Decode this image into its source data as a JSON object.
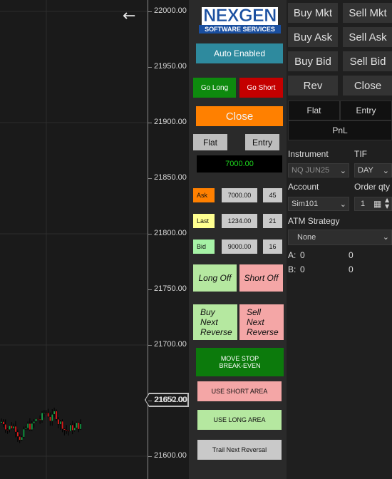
{
  "chart": {
    "price_ticks": [
      "22000.00",
      "21950.00",
      "21900.00",
      "21850.00",
      "21800.00",
      "21750.00",
      "21700.00",
      "21650.00",
      "21600.00"
    ],
    "current_price": "21652.00",
    "back_icon": "arrow-left-icon",
    "up_color": "#17a34a",
    "down_color": "#e01b1b"
  },
  "logo": {
    "top": "NEXGEN",
    "bottom": "SOFTWARE SERVICES"
  },
  "mid": {
    "auto": "Auto Enabled",
    "go_long": "Go Long",
    "go_short": "Go Short",
    "close": "Close",
    "flat": "Flat",
    "entry": "Entry",
    "display": "7000.00",
    "ask_label": "Ask",
    "ask_price": "7000.00",
    "ask_qty": "45",
    "last_label": "Last",
    "last_price": "1234.00",
    "last_qty": "21",
    "bid_label": "Bid",
    "bid_price": "9000.00",
    "bid_qty": "16",
    "long_off": "Long Off",
    "short_off": "Short Off",
    "buy_next_reverse": [
      "Buy",
      "Next",
      "Reverse"
    ],
    "sell_next_reverse": [
      "Sell",
      "Next",
      "Reverse"
    ],
    "move_stop": [
      "MOVE STOP",
      "BREAK-EVEN"
    ],
    "use_short_area": "USE SHORT AREA",
    "use_long_area": "USE LONG AREA",
    "trail_next_reversal": "Trail Next Reversal"
  },
  "right": {
    "buy_mkt": "Buy Mkt",
    "sell_mkt": "Sell Mkt",
    "buy_ask": "Buy Ask",
    "sell_ask": "Sell Ask",
    "buy_bid": "Buy Bid",
    "sell_bid": "Sell Bid",
    "rev": "Rev",
    "close": "Close",
    "flat": "Flat",
    "entry": "Entry",
    "pnl": "PnL",
    "instrument_label": "Instrument",
    "instrument_value": "NQ JUN25",
    "tif_label": "TIF",
    "tif_value": "DAY",
    "account_label": "Account",
    "account_value": "Sim101",
    "order_qty_label": "Order qty",
    "order_qty_value": "1",
    "atm_label": "ATM Strategy",
    "atm_value": "None",
    "a_label": "A:",
    "a_val1": "0",
    "a_val2": "0",
    "b_label": "B:",
    "b_val1": "0",
    "b_val2": "0"
  }
}
